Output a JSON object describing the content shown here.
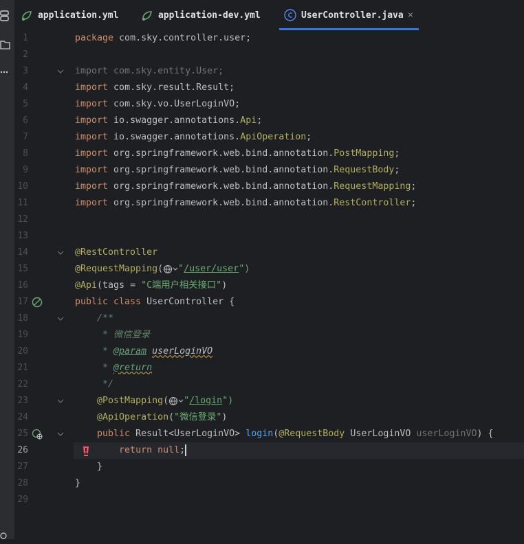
{
  "tabs": [
    {
      "label": "application.yml",
      "icon": "spring-leaf-icon",
      "active": false
    },
    {
      "label": "application-dev.yml",
      "icon": "spring-leaf-icon",
      "active": false
    },
    {
      "label": "UserController.java",
      "icon": "class-icon",
      "active": true,
      "close": "×"
    }
  ],
  "editor": {
    "line_numbers": [
      "1",
      "2",
      "3",
      "4",
      "5",
      "6",
      "7",
      "8",
      "9",
      "10",
      "11",
      "12",
      "13",
      "14",
      "15",
      "16",
      "17",
      "18",
      "19",
      "20",
      "21",
      "22",
      "23",
      "24",
      "25",
      "26",
      "27",
      "28",
      "29"
    ],
    "current_line": 26,
    "code": {
      "l1": [
        "package",
        " com.sky.controller.user;"
      ],
      "l3": [
        "import com.sky.entity.User;"
      ],
      "l4": [
        "import",
        " com.sky.result.Result;"
      ],
      "l5": [
        "import",
        " com.sky.vo.UserLoginVO;"
      ],
      "l6": [
        "import",
        " io.swagger.annotations.",
        "Api",
        ";"
      ],
      "l7": [
        "import",
        " io.swagger.annotations.",
        "ApiOperation",
        ";"
      ],
      "l8": [
        "import",
        " org.springframework.web.bind.annotation.",
        "PostMapping",
        ";"
      ],
      "l9": [
        "import",
        " org.springframework.web.bind.annotation.",
        "RequestBody",
        ";"
      ],
      "l10": [
        "import",
        " org.springframework.web.bind.annotation.",
        "RequestMapping",
        ";"
      ],
      "l11": [
        "import",
        " org.springframework.web.bind.annotation.",
        "RestController",
        ";"
      ],
      "l14": [
        "@RestController"
      ],
      "l15": [
        "@RequestMapping",
        "(",
        "\"",
        "/user/user",
        "\")"
      ],
      "l16": [
        "@Api",
        "(tags = ",
        "\"C端用户相关接口\"",
        ")"
      ],
      "l17": [
        "public class",
        " UserController {"
      ],
      "l18": [
        "    /**"
      ],
      "l19": [
        "     * 微信登录"
      ],
      "l20": [
        "     * ",
        "@param",
        " ",
        "userLoginVO"
      ],
      "l21": [
        "     * ",
        "@return"
      ],
      "l22": [
        "     */"
      ],
      "l23": [
        "    ",
        "@PostMapping",
        "(",
        "\"",
        "/login",
        "\")"
      ],
      "l24": [
        "    ",
        "@ApiOperation",
        "(",
        "\"微信登录\"",
        ")"
      ],
      "l25": [
        "    ",
        "public",
        " Result<UserLoginVO> ",
        "login",
        "(",
        "@RequestBody",
        " UserLoginVO ",
        "userLoginVO",
        ") {"
      ],
      "l26": [
        "        ",
        "return null",
        ";"
      ],
      "l27": [
        "    }"
      ],
      "l28": [
        "}"
      ]
    }
  },
  "colors": {
    "keyword": "#cf8e6d",
    "annotation": "#b3ae60",
    "string": "#6aab73",
    "comment": "#5f826b",
    "method": "#56a8f5",
    "accent": "#3574f0",
    "error": "#f75464"
  }
}
